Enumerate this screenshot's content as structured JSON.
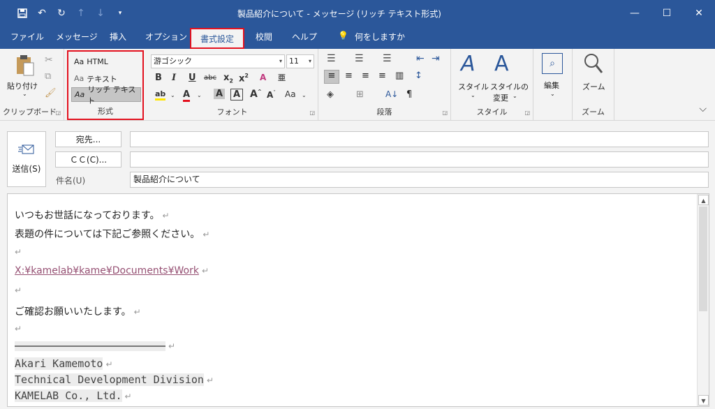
{
  "window": {
    "title": "製品紹介について  -  メッセージ (リッチ テキスト形式)",
    "qat_icons": [
      "save-icon",
      "undo-icon",
      "redo-icon",
      "up-arrow-icon",
      "down-arrow-icon",
      "customize-icon"
    ],
    "controls": [
      "minimize-icon",
      "maximize-icon",
      "close-icon"
    ]
  },
  "tabs": [
    "ファイル",
    "メッセージ",
    "挿入",
    "オプション",
    "書式設定",
    "校閲",
    "ヘルプ",
    "何をしますか"
  ],
  "ribbon": {
    "clipboard": {
      "paste": "貼り付け",
      "label": "クリップボード"
    },
    "format": {
      "html": "HTML",
      "text": "テキスト",
      "rich": "リッチ テキスト",
      "label": "形式",
      "aa": "Aa"
    },
    "font": {
      "name": "游ゴシック",
      "size": "11",
      "label": "フォント",
      "btn_case": "Aa"
    },
    "paragraph": {
      "label": "段落"
    },
    "style": {
      "styles": "スタイル",
      "change": "スタイルの",
      "change2": "変更",
      "label": "スタイル"
    },
    "edit": {
      "label": "編集"
    },
    "zoom": {
      "zoom": "ズーム",
      "label": "ズーム"
    }
  },
  "compose": {
    "send": "送信(S)",
    "to": "宛先...",
    "cc": "ＣＣ(C)...",
    "subject_label": "件名(U)",
    "subject": "製品紹介について",
    "to_value": "",
    "cc_value": ""
  },
  "body": {
    "line1": "いつもお世話になっております。",
    "line2": "表題の件については下記ご参照ください。",
    "link": "X:¥kamelab¥kame¥Documents¥Work",
    "line3": "ご確認お願いいたします。",
    "sig1": "Akari Kamemoto",
    "sig2": "Technical Development Division",
    "sig3": "KAMELAB Co., Ltd.",
    "ret": "↵"
  },
  "colors": {
    "accent": "#2b579a",
    "highlight_border": "#e3101e",
    "link": "#954f72"
  }
}
